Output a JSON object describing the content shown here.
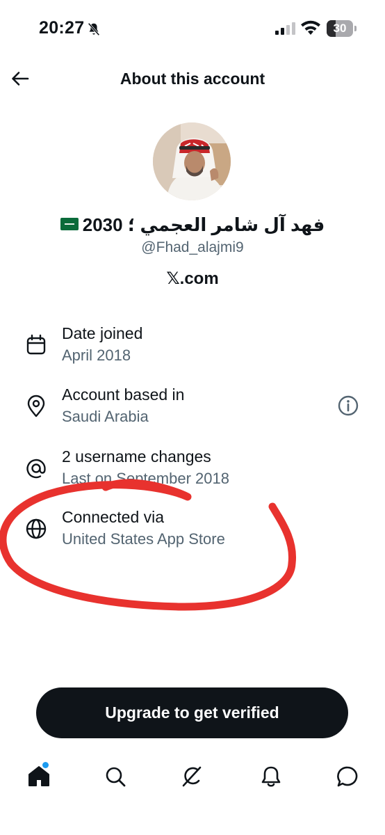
{
  "status_bar": {
    "time": "20:27",
    "battery": "30"
  },
  "header": {
    "title": "About this account"
  },
  "profile": {
    "display_name": "فهد آل شامر العجمي ؛ 2030",
    "handle": "@Fhad_alajmi9",
    "site": "𝕏.com"
  },
  "details": [
    {
      "label": "Date joined",
      "value": "April 2018",
      "icon": "calendar-icon"
    },
    {
      "label": "Account based in",
      "value": "Saudi Arabia",
      "icon": "location-pin-icon"
    },
    {
      "label": "2 username changes",
      "value": "Last on September 2018",
      "icon": "at-sign-icon"
    },
    {
      "label": "Connected via",
      "value": "United States App Store",
      "icon": "globe-icon"
    }
  ],
  "cta": {
    "label": "Upgrade to get verified"
  },
  "tabs": [
    "home-icon",
    "search-icon",
    "grok-icon",
    "notifications-icon",
    "messages-icon"
  ],
  "colors": {
    "accent": "#1d9bf0",
    "text": "#0f1419",
    "secondary": "#536471",
    "annotation": "#e8322e"
  }
}
